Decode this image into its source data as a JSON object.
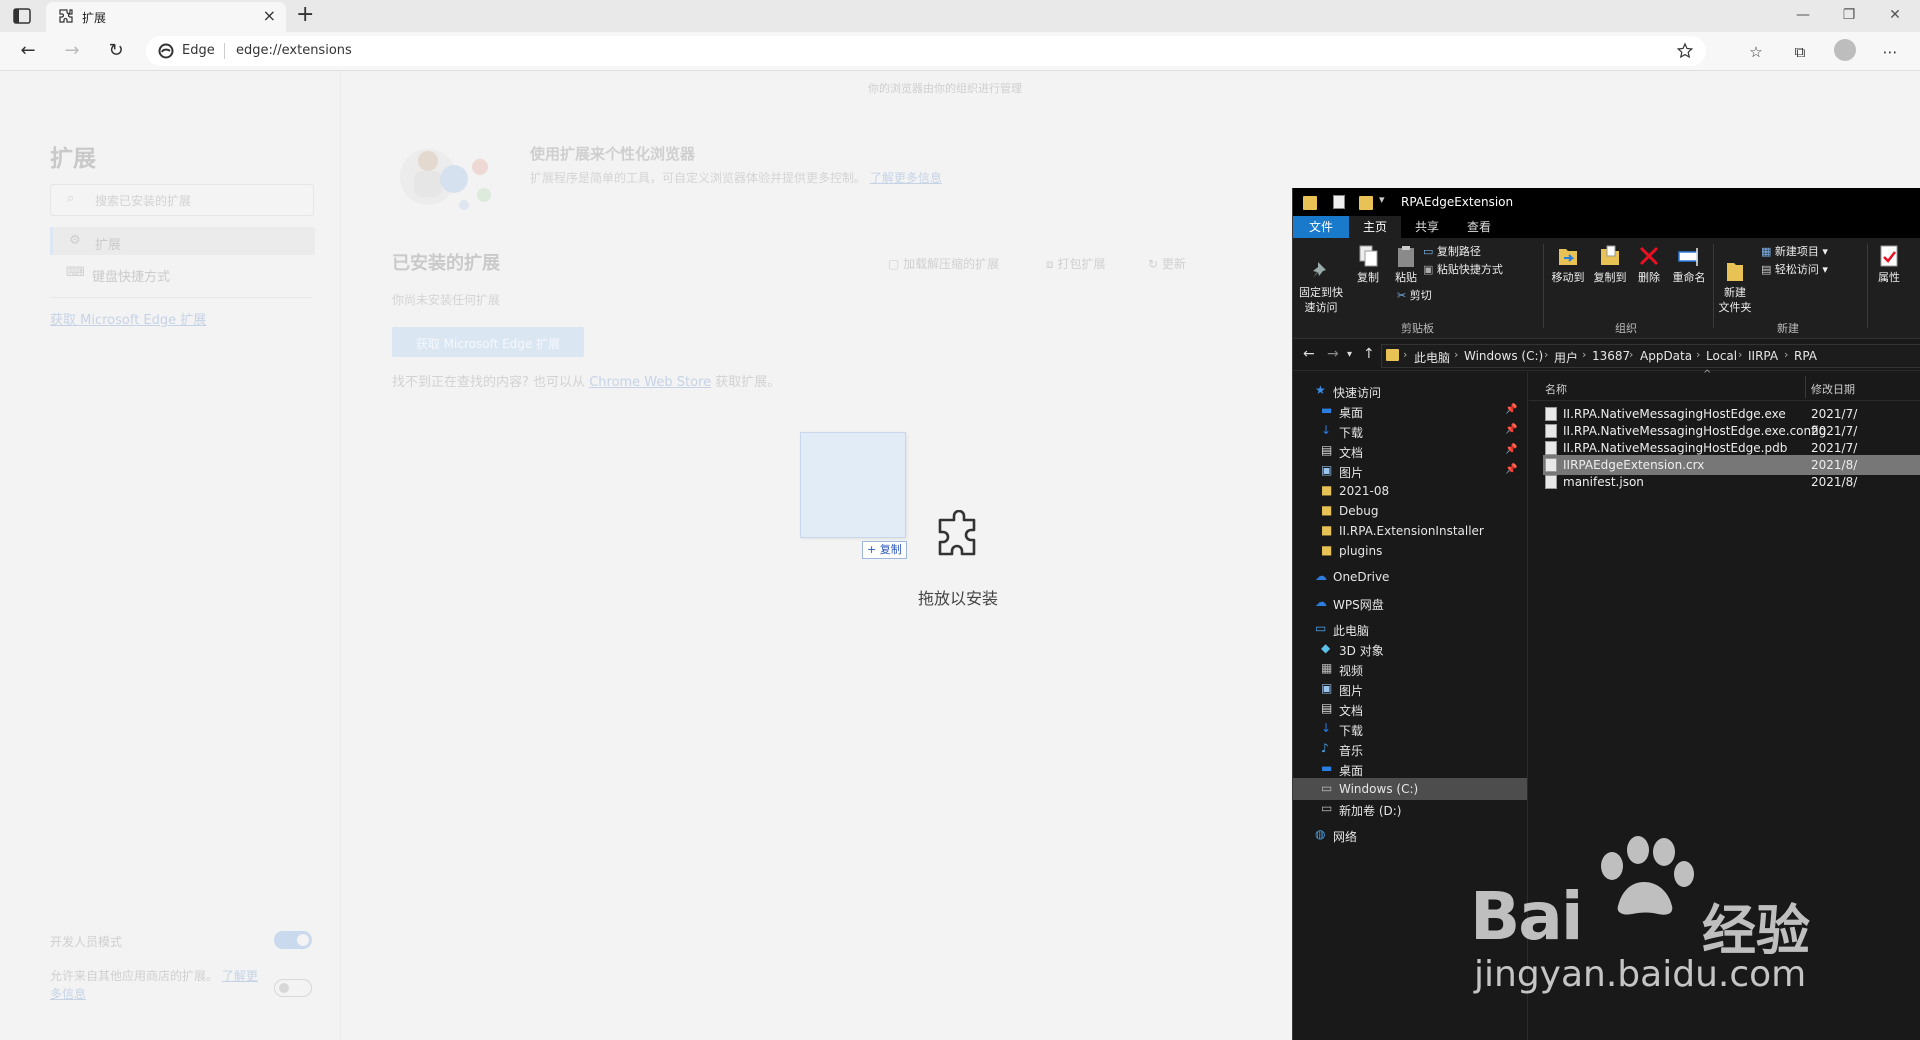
{
  "browser": {
    "tab_title": "扩展",
    "brand": "Edge",
    "url": "edge://extensions"
  },
  "page": {
    "managed_notice": "你的浏览器由你的组织进行管理",
    "sidebar": {
      "title": "扩展",
      "search_placeholder": "搜索已安装的扩展",
      "items": [
        {
          "label": "扩展"
        },
        {
          "label": "键盘快捷方式"
        }
      ],
      "get_link": "获取 Microsoft Edge 扩展",
      "dev_mode_label": "开发人员模式",
      "allow_other_stores": "允许来自其他应用商店的扩展。",
      "learn_more": "了解更多信息"
    },
    "hero": {
      "title": "使用扩展来个性化浏览器",
      "desc": "扩展程序是简单的工具，可自定义浏览器体验并提供更多控制。",
      "learn_more": "了解更多信息"
    },
    "installed": {
      "title": "已安装的扩展",
      "actions": [
        "加载解压缩的扩展",
        "打包扩展",
        "更新"
      ],
      "none_msg": "你尚未安装任何扩展",
      "get_button": "获取 Microsoft Edge 扩展",
      "find_prefix": "找不到正在查找的内容? 也可以从",
      "find_link": "Chrome Web Store",
      "find_suffix": "获取扩展。"
    },
    "drag": {
      "copy_tag": "+ 复制",
      "drop_label": "拖放以安装"
    }
  },
  "explorer": {
    "title": "RPAEdgeExtension",
    "ribbon_tabs": [
      "文件",
      "主页",
      "共享",
      "查看"
    ],
    "ribbon": {
      "pin_quick": "固定到快\n速访问",
      "copy": "复制",
      "paste": "粘贴",
      "copy_path": "复制路径",
      "paste_shortcut": "粘贴快捷方式",
      "cut": "剪切",
      "group_clipboard": "剪贴板",
      "move_to": "移动到",
      "copy_to": "复制到",
      "delete": "删除",
      "rename": "重命名",
      "group_organize": "组织",
      "new_folder": "新建\n文件夹",
      "new_item": "新建项目",
      "easy_access": "轻松访问",
      "group_new": "新建",
      "properties": "属性"
    },
    "breadcrumb": [
      "此电脑",
      "Windows (C:)",
      "用户",
      "13687",
      "AppData",
      "Local",
      "IIRPA",
      "RPA"
    ],
    "columns": {
      "name": "名称",
      "date": "修改日期"
    },
    "nav": [
      {
        "label": "快速访问",
        "kind": "star"
      },
      {
        "label": "桌面",
        "kind": "desktop",
        "pinned": true
      },
      {
        "label": "下载",
        "kind": "down",
        "pinned": true
      },
      {
        "label": "文档",
        "kind": "doc",
        "pinned": true
      },
      {
        "label": "图片",
        "kind": "pic",
        "pinned": true
      },
      {
        "label": "2021-08",
        "kind": "folder"
      },
      {
        "label": "Debug",
        "kind": "folder"
      },
      {
        "label": "II.RPA.ExtensionInstaller",
        "kind": "folder"
      },
      {
        "label": "plugins",
        "kind": "folder"
      },
      {
        "label": "OneDrive",
        "kind": "cloud"
      },
      {
        "label": "WPS网盘",
        "kind": "cloud"
      },
      {
        "label": "此电脑",
        "kind": "pc"
      },
      {
        "label": "3D 对象",
        "kind": "cube"
      },
      {
        "label": "视频",
        "kind": "video"
      },
      {
        "label": "图片",
        "kind": "pic"
      },
      {
        "label": "文档",
        "kind": "doc"
      },
      {
        "label": "下载",
        "kind": "down"
      },
      {
        "label": "音乐",
        "kind": "music"
      },
      {
        "label": "桌面",
        "kind": "desktop"
      },
      {
        "label": "Windows (C:)",
        "kind": "drive",
        "selected": true
      },
      {
        "label": "新加卷 (D:)",
        "kind": "drive"
      },
      {
        "label": "网络",
        "kind": "network"
      }
    ],
    "files": [
      {
        "name": "II.RPA.NativeMessagingHostEdge.exe",
        "date": "2021/7/"
      },
      {
        "name": "II.RPA.NativeMessagingHostEdge.exe.config",
        "date": "2021/7/"
      },
      {
        "name": "II.RPA.NativeMessagingHostEdge.pdb",
        "date": "2021/7/"
      },
      {
        "name": "IIRPAEdgeExtension.crx",
        "date": "2021/8/",
        "selected": true
      },
      {
        "name": "manifest.json",
        "date": "2021/8/"
      }
    ]
  },
  "watermark": {
    "brand": "Bai",
    "cn": "经验",
    "url": "jingyan.baidu.com"
  }
}
